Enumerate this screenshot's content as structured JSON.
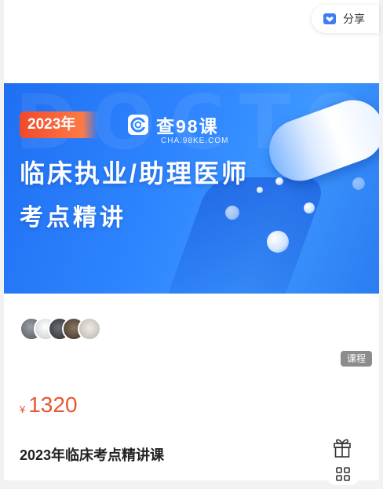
{
  "share": {
    "label": "分享",
    "icon": "share-icon"
  },
  "banner": {
    "watermark": "DOCTOR",
    "year_badge": "2023年",
    "brand_name": "查98课",
    "brand_url": "CHA.98KE.COM",
    "headline": "临床执业/助理医师",
    "subline": "考点精讲",
    "colors": {
      "primary": "#2f86ff",
      "badge": "#ef4a2b"
    }
  },
  "avatars": [
    {
      "name": "avatar-1",
      "color": "#6b6f74"
    },
    {
      "name": "avatar-2",
      "color": "#d7d9dc"
    },
    {
      "name": "avatar-3",
      "color": "#3b3f44"
    },
    {
      "name": "avatar-4",
      "color": "#5a4d3f"
    },
    {
      "name": "avatar-5",
      "color": "#cfcac4"
    }
  ],
  "tag": "课程",
  "price": {
    "currency": "¥",
    "value": "1320",
    "color": "#e8552f"
  },
  "title": "2023年临床考点精讲课",
  "floating": {
    "gift_icon": "gift-icon",
    "apps_icon": "apps-icon"
  }
}
